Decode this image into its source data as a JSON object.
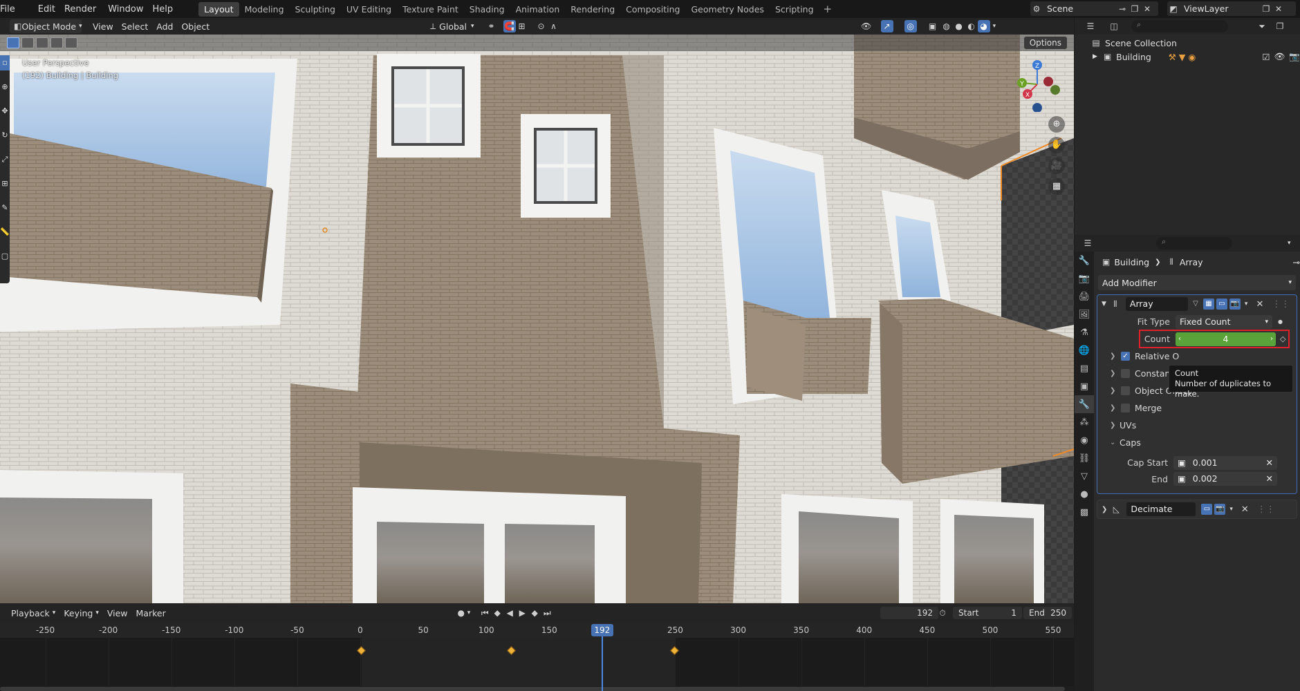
{
  "topbar": {
    "menus": [
      "File",
      "Edit",
      "Render",
      "Window",
      "Help"
    ],
    "workspaces": [
      "Layout",
      "Modeling",
      "Sculpting",
      "UV Editing",
      "Texture Paint",
      "Shading",
      "Animation",
      "Rendering",
      "Compositing",
      "Geometry Nodes",
      "Scripting"
    ],
    "active_workspace": "Layout",
    "scene_name": "Scene",
    "view_layer": "ViewLayer"
  },
  "viewport_header": {
    "mode": "Object Mode",
    "menus": [
      "View",
      "Select",
      "Add",
      "Object"
    ],
    "orientation": "Global",
    "options_label": "Options"
  },
  "viewport": {
    "perspective_label": "User Perspective",
    "object_info": "(192) Building | Building",
    "gizmo_axes": [
      "X",
      "Y",
      "Z"
    ]
  },
  "outliner": {
    "collection": "Scene Collection",
    "object": "Building"
  },
  "properties": {
    "breadcrumb": [
      "Building",
      "Array"
    ],
    "add_modifier": "Add Modifier",
    "array_modifier": {
      "name": "Array",
      "fit_type_label": "Fit Type",
      "fit_type": "Fixed Count",
      "count_label": "Count",
      "count": "4",
      "sections": [
        {
          "label": "Relative O",
          "checkbox": true
        },
        {
          "label": "Constant",
          "checkbox": false
        },
        {
          "label": "Object Offset",
          "checkbox": false
        },
        {
          "label": "Merge",
          "checkbox": false
        },
        {
          "label": "UVs",
          "checkbox": null
        },
        {
          "label": "Caps",
          "checkbox": null
        }
      ],
      "cap_start_label": "Cap Start",
      "cap_start": "0.001",
      "cap_end_label": "End",
      "cap_end": "0.002"
    },
    "decimate_modifier": {
      "name": "Decimate"
    }
  },
  "tooltip": {
    "title": "Count",
    "description": "Number of duplicates to make."
  },
  "timeline": {
    "menus": [
      "Playback",
      "Keying",
      "View",
      "Marker"
    ],
    "current_frame": "192",
    "start_label": "Start",
    "start": "1",
    "end_label": "End",
    "end": "250",
    "playhead_frame": 192,
    "tick_labels": [
      "-250",
      "-200",
      "-150",
      "-100",
      "-50",
      "0",
      "50",
      "100",
      "150",
      "192",
      "250",
      "300",
      "350",
      "400",
      "450",
      "500",
      "550"
    ],
    "keyframes": [
      1,
      120,
      250
    ]
  },
  "colors": {
    "accent": "#4772b3",
    "count_field": "#5aa23a",
    "keyframe": "#f0b33a",
    "selection_outline": "#f08a24",
    "highlight_box": "#e0202a"
  }
}
